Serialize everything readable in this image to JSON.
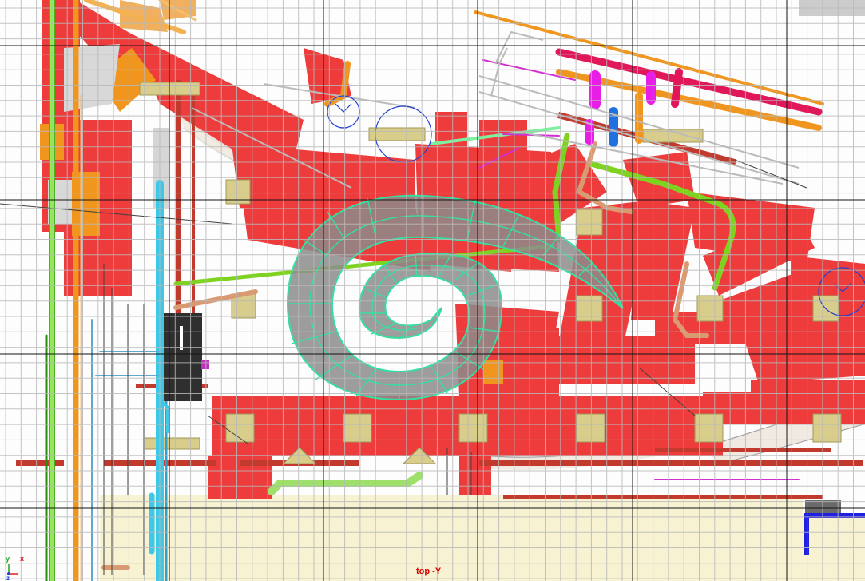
{
  "viewport": {
    "label": "top -Y",
    "axis": {
      "y": "y",
      "x": "x",
      "z": "z"
    }
  },
  "colors": {
    "background": "#fdfdfd",
    "grid_minor": "#b9b9b9",
    "grid_major": "#141414",
    "duct_red": "#ee3b3b",
    "duct_dark_red": "#c23a2e",
    "spiral_fill": "#8c8c8c",
    "spiral_wire": "#33e0a0",
    "floor_cream": "#f6f2d2",
    "pipe_green": "#7ed321",
    "pipe_orange": "#f0961e",
    "pipe_copper": "#d99a72",
    "pipe_cyan": "#3cc8e6",
    "pipe_magenta": "#e61ee6",
    "pipe_blue": "#2070e0",
    "pad_khaki": "#d8cd8a",
    "label_red": "#e00000"
  },
  "objects": [
    "spiral-ramp",
    "ductwork",
    "pipe-runs",
    "structural-columns",
    "floor-slab",
    "equipment-box"
  ]
}
